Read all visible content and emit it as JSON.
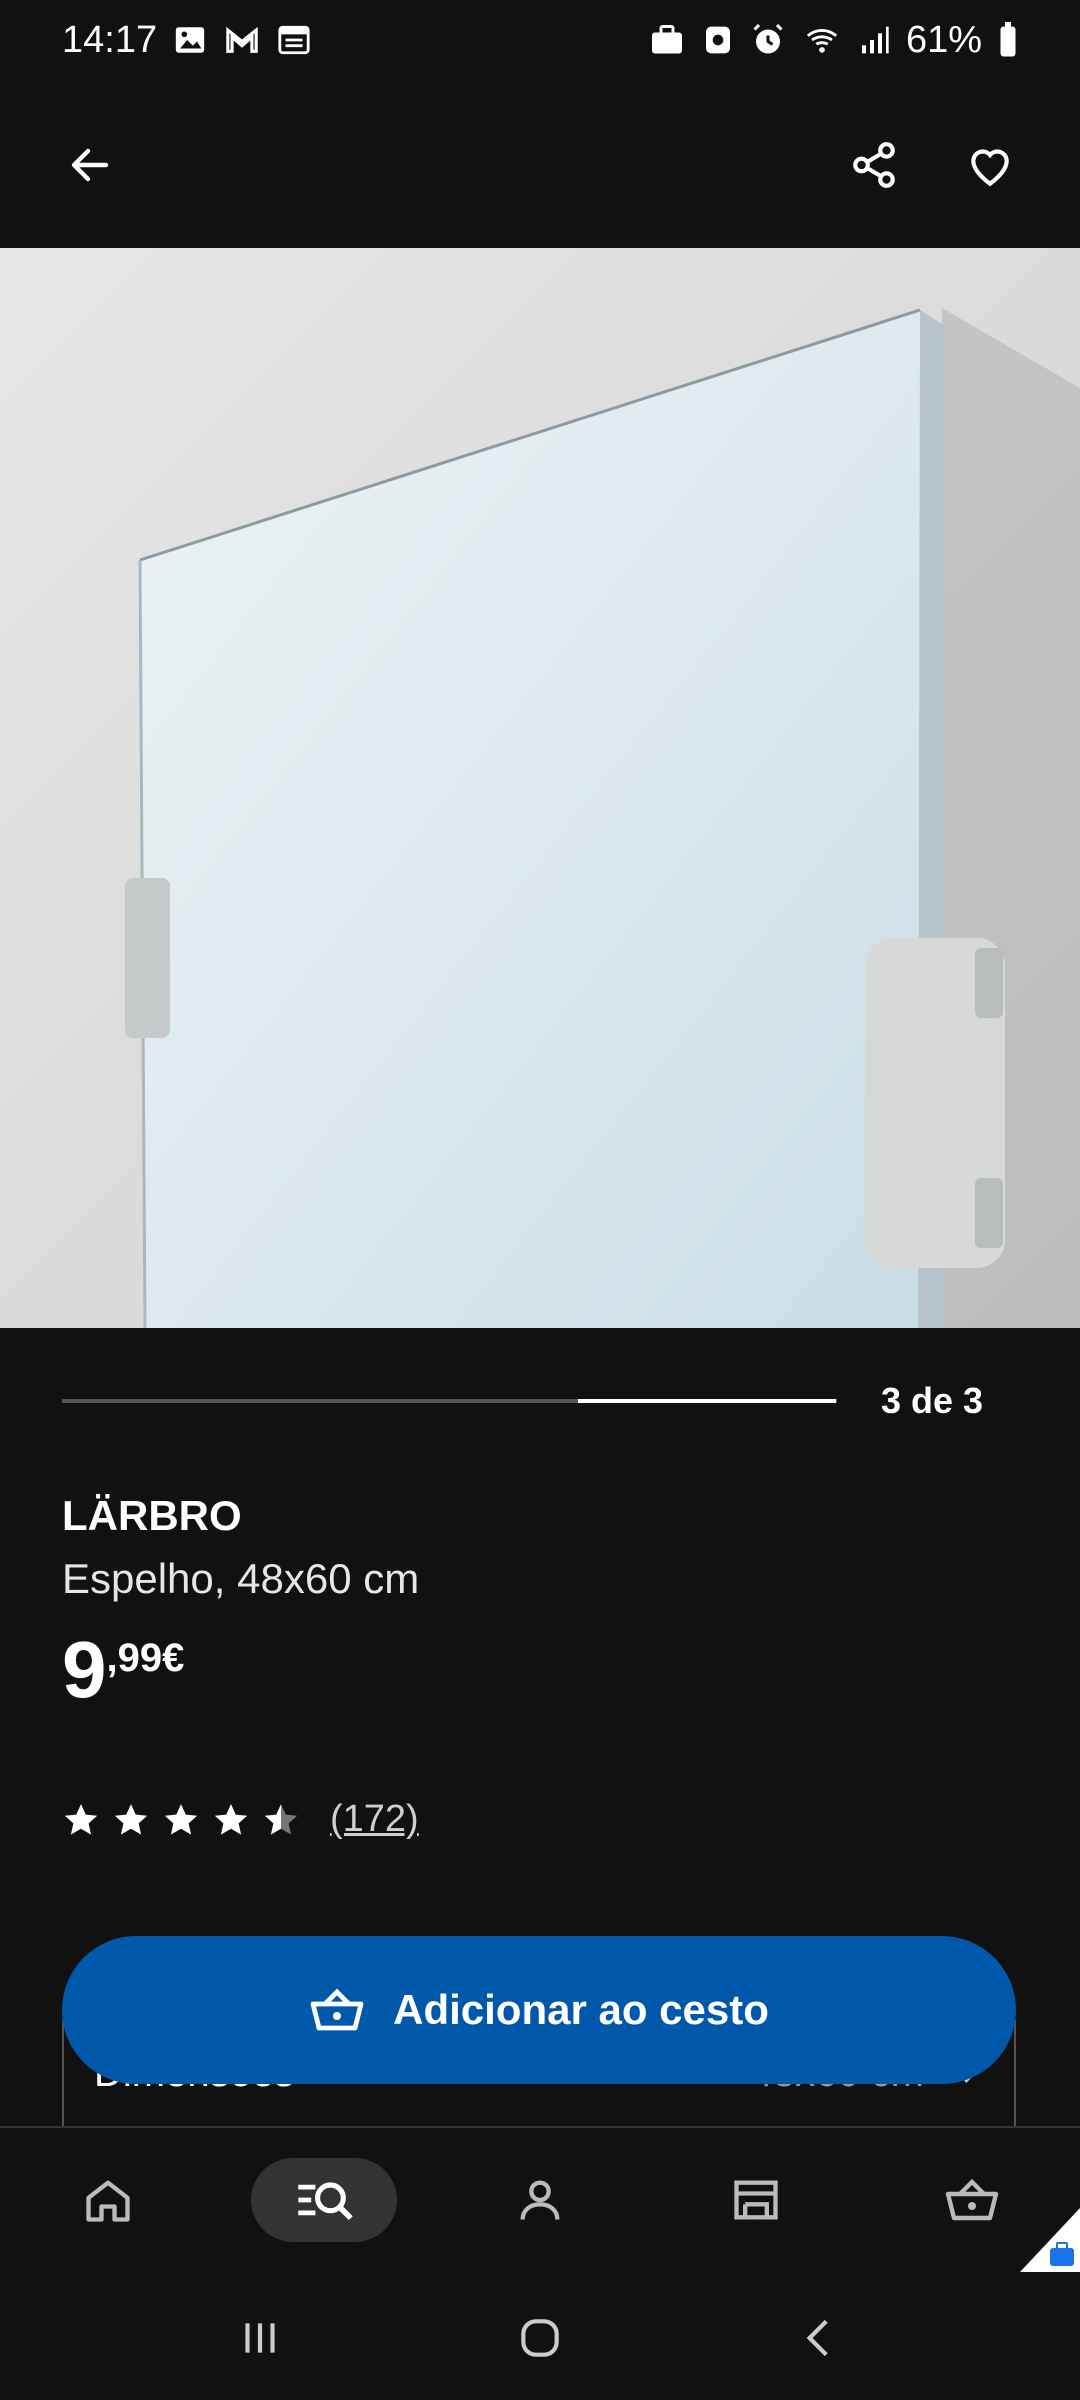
{
  "status": {
    "time": "14:17",
    "battery": "61%"
  },
  "topbar": {
    "back_icon": "arrow-left-icon",
    "share_icon": "share-icon",
    "favorite_icon": "heart-icon"
  },
  "gallery": {
    "counter": "3 de 3",
    "current": 3,
    "total": 3
  },
  "product": {
    "name": "LÄRBRO",
    "description": "Espelho, 48x60 cm",
    "price_integer": "9",
    "price_decimal": ",99€",
    "rating": 4.5,
    "rating_count": "(172)"
  },
  "dimensions": {
    "label": "Dimensões",
    "value": "48x60 cm"
  },
  "actions": {
    "add_to_cart": "Adicionar ao cesto"
  },
  "colors": {
    "background": "#111111",
    "primary_button": "#0058ab"
  }
}
